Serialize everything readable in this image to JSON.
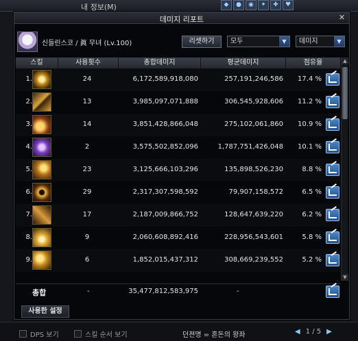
{
  "background": {
    "title": "내 정보(M)",
    "bottom": {
      "dps_label": "DPS 보기",
      "skill_order_label": "스킬 순서 보기",
      "nickname_line": "던젼명 = 혼돈의 왕좌",
      "page": "1 / 5"
    }
  },
  "report": {
    "title": "데미지 리포트",
    "character": "신들린스코 / 眞 무녀 (Lv.100)",
    "reset_label": "리셋하기",
    "filter_value": "모두",
    "metric_value": "데미지",
    "columns": {
      "skill": "스킬",
      "count": "사용횟수",
      "total": "총합데미지",
      "avg": "평균데미지",
      "share": "점유율"
    },
    "rows": [
      {
        "idx": "1.",
        "count": "24",
        "total": "6,172,589,918,080",
        "avg": "257,191,246,586",
        "share": "17.4 %"
      },
      {
        "idx": "2.",
        "count": "13",
        "total": "3,985,097,071,888",
        "avg": "306,545,928,606",
        "share": "11.2 %"
      },
      {
        "idx": "3.",
        "count": "14",
        "total": "3,851,428,866,048",
        "avg": "275,102,061,860",
        "share": "10.9 %"
      },
      {
        "idx": "4.",
        "count": "2",
        "total": "3,575,502,852,096",
        "avg": "1,787,751,426,048",
        "share": "10.1 %"
      },
      {
        "idx": "5.",
        "count": "23",
        "total": "3,125,666,103,296",
        "avg": "135,898,526,230",
        "share": "8.8 %"
      },
      {
        "idx": "6.",
        "count": "29",
        "total": "2,317,307,598,592",
        "avg": "79,907,158,572",
        "share": "6.5 %"
      },
      {
        "idx": "7.",
        "count": "17",
        "total": "2,187,009,866,752",
        "avg": "128,647,639,220",
        "share": "6.2 %"
      },
      {
        "idx": "8.",
        "count": "9",
        "total": "2,060,608,892,416",
        "avg": "228,956,543,601",
        "share": "5.8 %"
      },
      {
        "idx": "9.",
        "count": "6",
        "total": "1,852,015,437,312",
        "avg": "308,669,239,552",
        "share": "5.2 %"
      }
    ],
    "total": {
      "label": "총합",
      "count": "-",
      "value": "35,477,812,583,975",
      "avg": "-"
    },
    "settings_tab": "사용한 설정"
  }
}
